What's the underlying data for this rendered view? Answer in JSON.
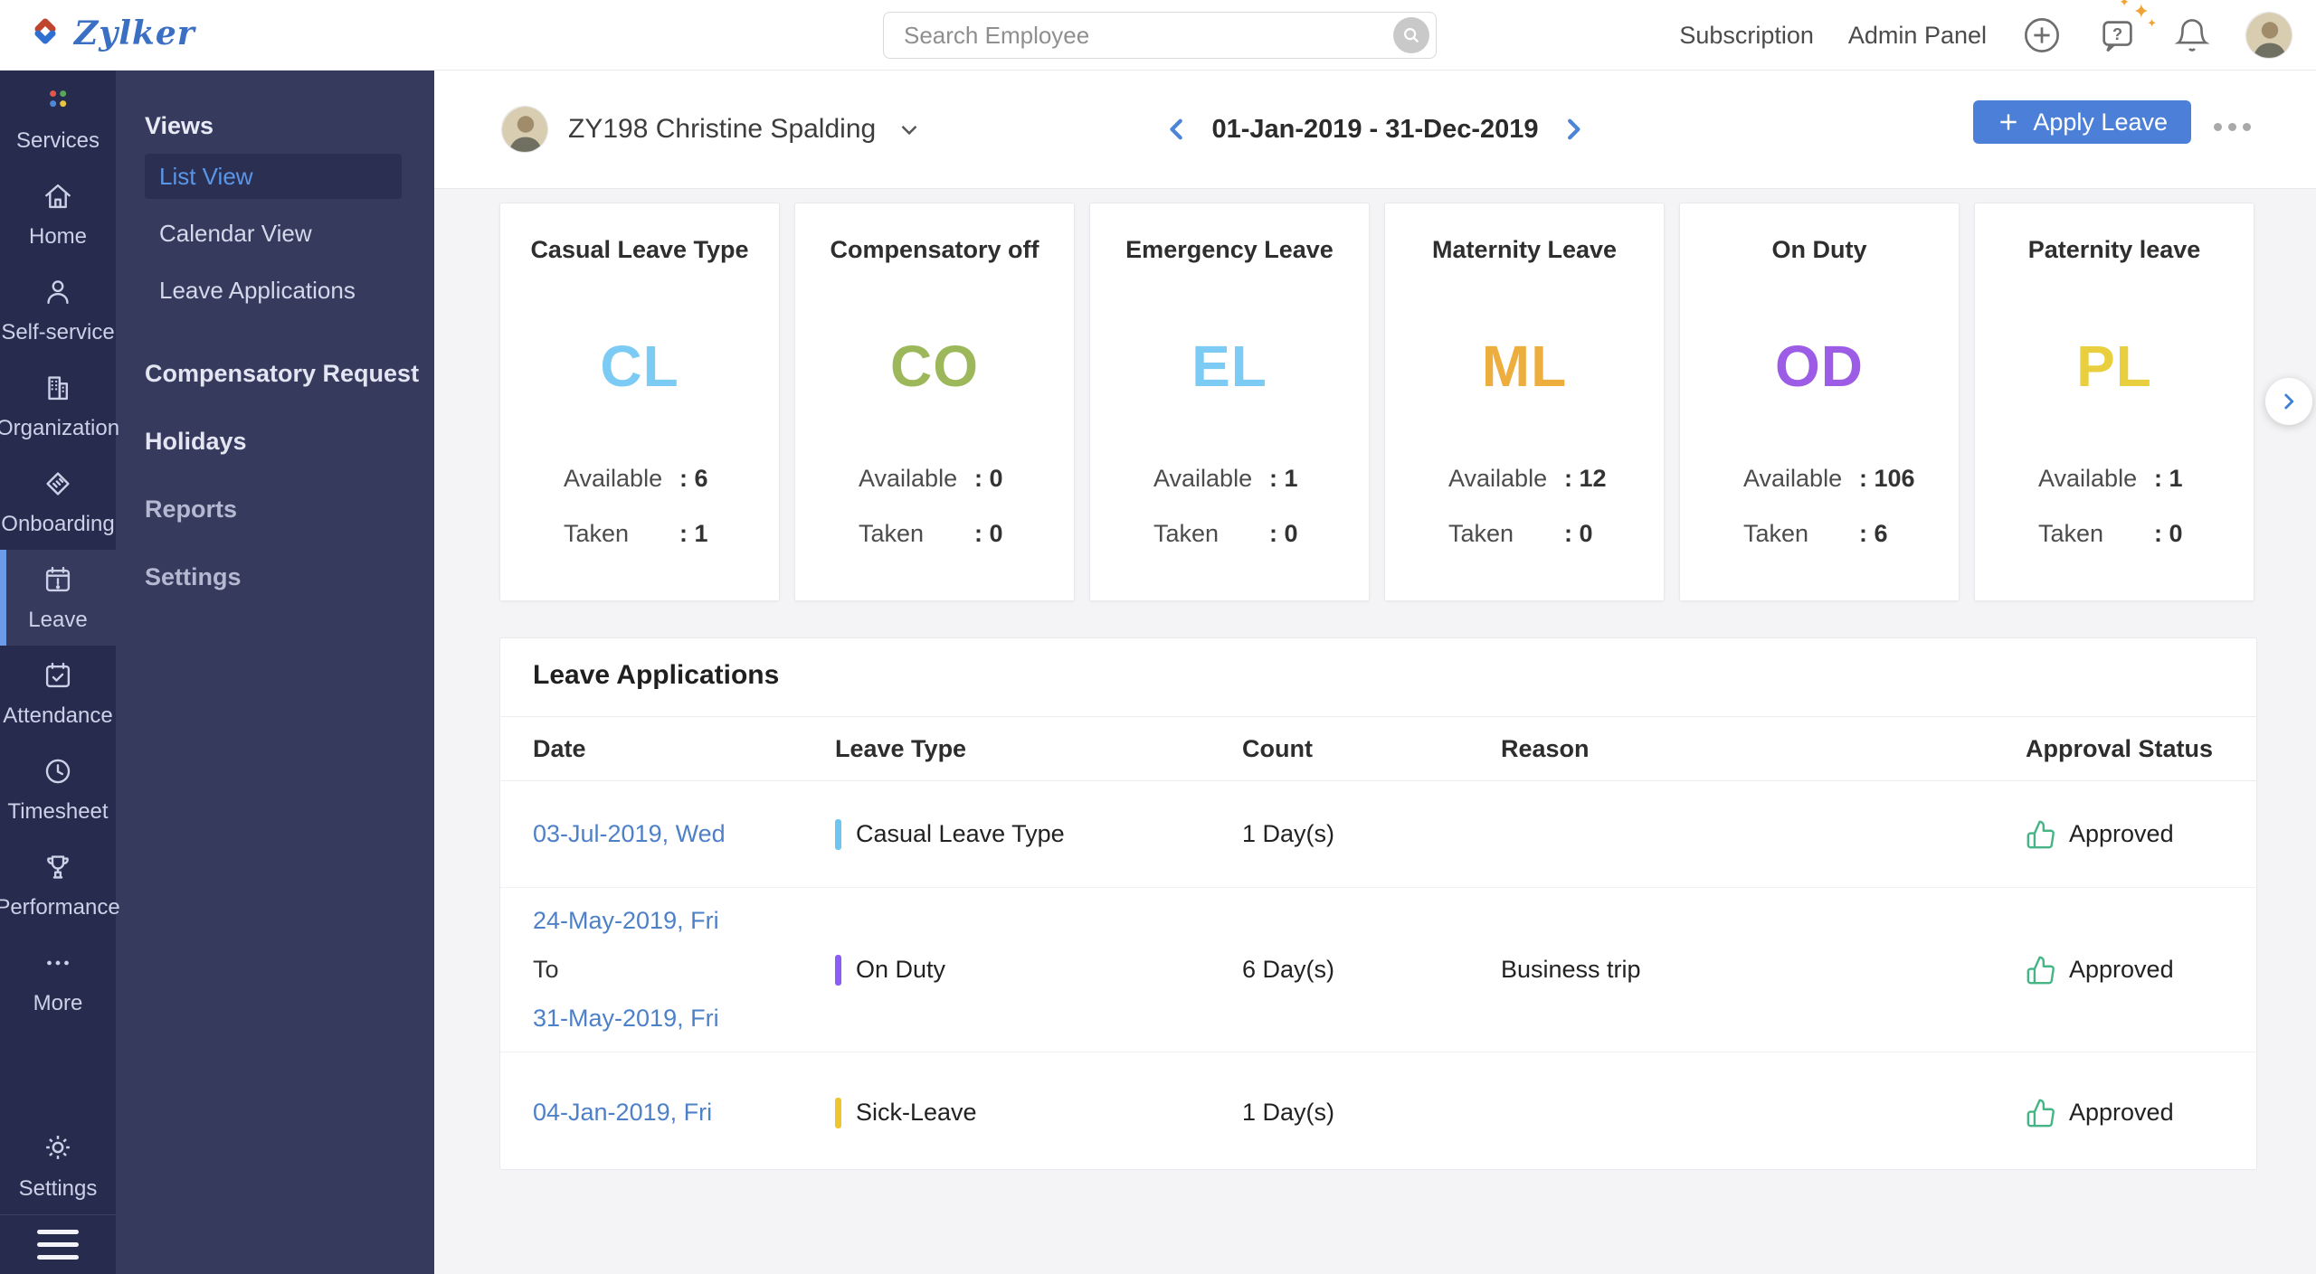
{
  "topbar": {
    "logo_text": "Zylker",
    "search": {
      "placeholder": "Search Employee",
      "icon": "search-icon"
    },
    "links": {
      "subscription": "Subscription",
      "admin_panel": "Admin Panel"
    },
    "icons": [
      "plus-circle-icon",
      "help-chat-icon",
      "bell-icon",
      "user-avatar"
    ]
  },
  "sidebar": {
    "items": [
      {
        "label": "Services",
        "icon": "services-icon",
        "active": false
      },
      {
        "label": "Home",
        "icon": "home-icon",
        "active": false
      },
      {
        "label": "Self-service",
        "icon": "self-service-icon",
        "active": false
      },
      {
        "label": "Organization",
        "icon": "organization-icon",
        "active": false
      },
      {
        "label": "Onboarding",
        "icon": "onboarding-icon",
        "active": false
      },
      {
        "label": "Leave",
        "icon": "leave-icon",
        "active": true
      },
      {
        "label": "Attendance",
        "icon": "attendance-icon",
        "active": false
      },
      {
        "label": "Timesheet",
        "icon": "timesheet-icon",
        "active": false
      },
      {
        "label": "Performance",
        "icon": "performance-icon",
        "active": false
      },
      {
        "label": "More",
        "icon": "more-icon",
        "active": false
      }
    ],
    "bottom": {
      "settings_label": "Settings",
      "settings_icon": "gear-icon",
      "menu_icon": "hamburger-icon"
    }
  },
  "subnav": {
    "section_title": "Views",
    "view_items": [
      {
        "label": "List View",
        "active": true
      },
      {
        "label": "Calendar View",
        "active": false
      },
      {
        "label": "Leave Applications",
        "active": false
      }
    ],
    "links": [
      {
        "label": "Compensatory Request",
        "tone": "bright"
      },
      {
        "label": "Holidays",
        "tone": "bright"
      },
      {
        "label": "Reports",
        "tone": "dim"
      },
      {
        "label": "Settings",
        "tone": "dim"
      }
    ]
  },
  "content_header": {
    "employee_name": "ZY198 Christine Spalding",
    "date_range": "01-Jan-2019 - 31-Dec-2019",
    "apply_leave_label": "Apply Leave",
    "icons": [
      "chevron-down-icon",
      "chevron-left-icon",
      "chevron-right-icon",
      "ellipsis-icon"
    ]
  },
  "labels": {
    "available": "Available",
    "taken": "Taken"
  },
  "leave_cards": [
    {
      "title": "Casual Leave Type",
      "code": "CL",
      "code_color": "#7ccbf5",
      "available": ": 6",
      "taken": ": 1"
    },
    {
      "title": "Compensatory off",
      "code": "CO",
      "code_color": "#9db85a",
      "available": ": 0",
      "taken": ": 0"
    },
    {
      "title": "Emergency Leave",
      "code": "EL",
      "code_color": "#7ccbf5",
      "available": ": 1",
      "taken": ": 0"
    },
    {
      "title": "Maternity Leave",
      "code": "ML",
      "code_color": "#edae3e",
      "available": ": 12",
      "taken": ": 0"
    },
    {
      "title": "On Duty",
      "code": "OD",
      "code_color": "#9d5ce6",
      "available": ": 106",
      "taken": ": 6"
    },
    {
      "title": "Paternity leave",
      "code": "PL",
      "code_color": "#e9ce3e",
      "available": ": 1",
      "taken": ": 0"
    }
  ],
  "leave_table": {
    "title": "Leave Applications",
    "columns": [
      "Date",
      "Leave Type",
      "Count",
      "Reason",
      "Approval Status"
    ],
    "rows": [
      {
        "date_lines": [
          {
            "text": "03-Jul-2019, Wed",
            "link": true
          }
        ],
        "leave_type": "Casual Leave Type",
        "bar_color": "#6ec6f0",
        "count": "1 Day(s)",
        "reason": "",
        "status": "Approved"
      },
      {
        "date_lines": [
          {
            "text": "24-May-2019, Fri",
            "link": true
          },
          {
            "text": "To",
            "link": false
          },
          {
            "text": "31-May-2019, Fri",
            "link": true
          }
        ],
        "leave_type": "On Duty",
        "bar_color": "#8b5cf6",
        "count": "6 Day(s)",
        "reason": "Business trip",
        "status": "Approved"
      },
      {
        "date_lines": [
          {
            "text": "04-Jan-2019, Fri",
            "link": true
          }
        ],
        "leave_type": "Sick-Leave",
        "bar_color": "#efc52f",
        "count": "1 Day(s)",
        "reason": "",
        "status": "Approved"
      }
    ],
    "status_icon": "thumbs-up-icon",
    "status_color": "#45b586"
  },
  "colors": {
    "sidebar_dark": "#272c4e",
    "sidebar_panel": "#363b5e",
    "active_bar_blue": "#6c9be8",
    "accent_blue": "#4c80d8",
    "link_blue": "#4e80c8",
    "approved_green": "#45b586"
  }
}
